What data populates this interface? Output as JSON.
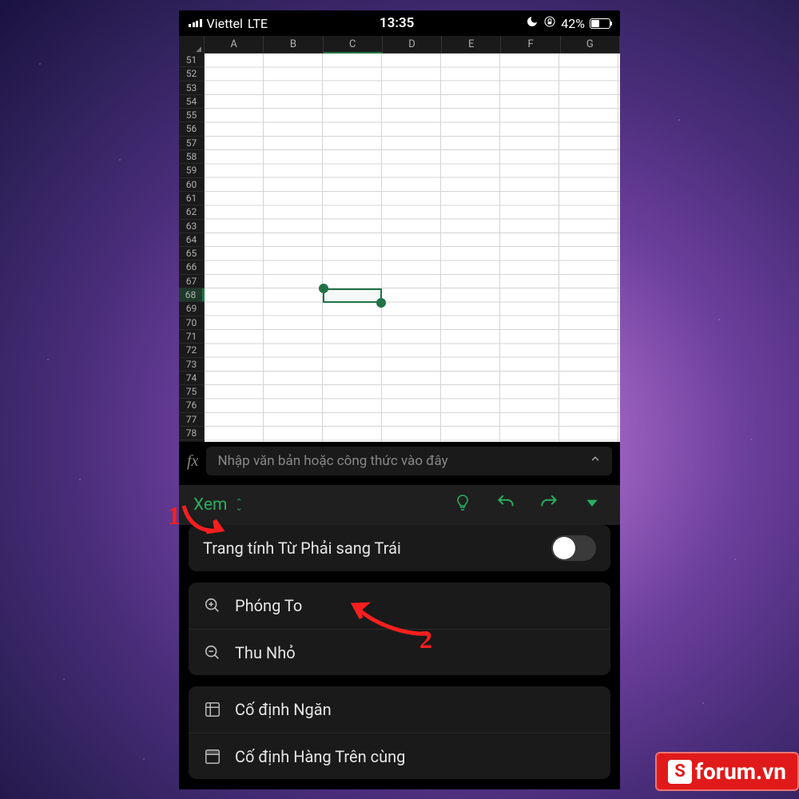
{
  "status_bar": {
    "carrier": "Viettel",
    "network": "LTE",
    "time": "13:35",
    "battery_pct": "42%"
  },
  "sheet": {
    "columns": [
      "A",
      "B",
      "C",
      "D",
      "E",
      "F",
      "G"
    ],
    "row_start": 51,
    "row_end": 78,
    "selected_column": "C",
    "selected_row": 68
  },
  "formula_bar": {
    "fx_label": "fx",
    "placeholder": "Nhập văn bản hoặc công thức vào đây"
  },
  "ribbon": {
    "active_tab": "Xem"
  },
  "options": {
    "rtl_sheet": {
      "label": "Trang tính Từ Phải sang Trái",
      "value": false
    },
    "zoom_in": "Phóng To",
    "zoom_out": "Thu Nhỏ",
    "freeze_panes": "Cố định Ngăn",
    "freeze_top_row": "Cố định Hàng Trên cùng"
  },
  "annotations": {
    "step1": "1",
    "step2": "2"
  },
  "watermark": {
    "icon_letter": "S",
    "text": "forum.vn"
  },
  "colors": {
    "brand_green": "#217346",
    "accent_green": "#2aae5f",
    "annotation_red": "#fa1f1f"
  }
}
